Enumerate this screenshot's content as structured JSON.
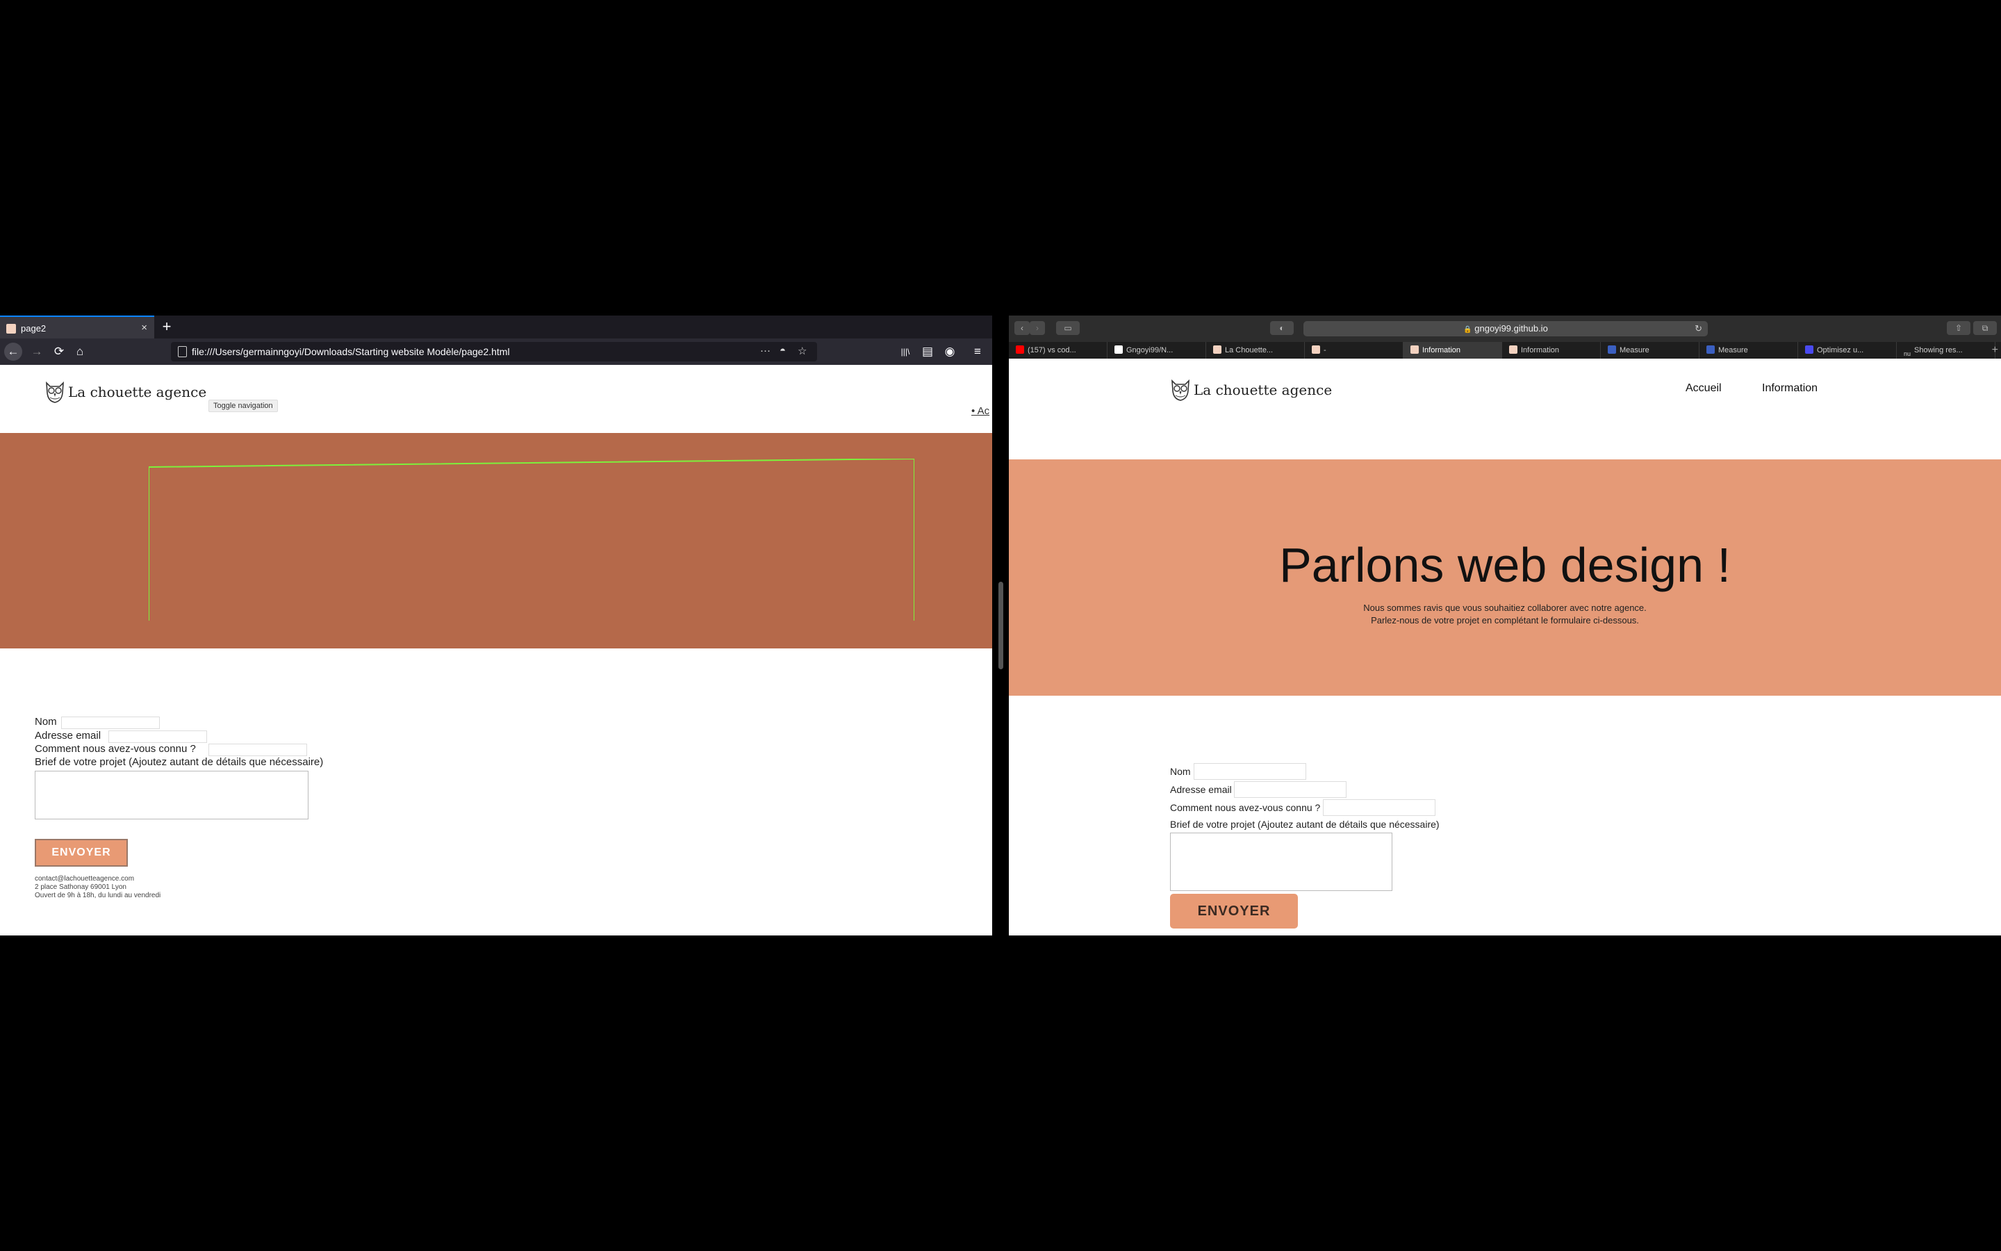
{
  "left_window": {
    "tab": {
      "title": "page2",
      "close": "×",
      "new_tab": "+"
    },
    "nav": {
      "back": "←",
      "forward": "→",
      "reload": "⟳",
      "home": "⌂"
    },
    "url": "file:///Users/germainngoyi/Downloads/Starting website Modèle/page2.html",
    "url_icons": {
      "more": "···",
      "pocket": "◓",
      "bookmark": "☆"
    },
    "toolbar_icons": {
      "library": "|||\\",
      "sidebar": "▤",
      "account": "◉",
      "menu": "≡"
    },
    "page": {
      "brand": "La chouette agence",
      "toggle_nav": "Toggle navigation",
      "nav_partial": "• Ac",
      "form": {
        "name_label": "Nom",
        "email_label": "Adresse email",
        "source_label": "Comment nous avez-vous connu ?",
        "brief_label": "Brief de votre projet (Ajoutez autant de détails que nécessaire)",
        "submit": "ENVOYER"
      },
      "footer": {
        "email": "contact@lachouetteagence.com",
        "address": "2 place Sathonay 69001 Lyon",
        "hours": "Ouvert de 9h à 18h, du lundi au vendredi"
      }
    }
  },
  "right_window": {
    "toolbar": {
      "back": "‹",
      "forward": "›",
      "sidebar": "▭",
      "shield": "◐",
      "address": "gngoyi99.github.io",
      "lock": "🔒",
      "reload": "↻",
      "share": "⇧",
      "tabs_overview": "⧉",
      "new_tab": "+"
    },
    "tabs": [
      {
        "label": "(157) vs cod...",
        "color": "#ff0000"
      },
      {
        "label": "Gngoyi99/N...",
        "color": "#ffffff"
      },
      {
        "label": "La Chouette...",
        "color": "#f3d2c0"
      },
      {
        "label": "-",
        "color": "#f3d2c0"
      },
      {
        "label": "Information",
        "color": "#f3d2c0",
        "active": true
      },
      {
        "label": "Information",
        "color": "#f3d2c0"
      },
      {
        "label": "Measure",
        "color": "#3b5fc0"
      },
      {
        "label": "Measure",
        "color": "#3b5fc0"
      },
      {
        "label": "Optimisez u...",
        "color": "#4a4af0"
      },
      {
        "label": "Showing res...",
        "color": "#1e1e1e",
        "prefix": "nu"
      }
    ],
    "page": {
      "brand": "La chouette agence",
      "nav": {
        "home": "Accueil",
        "info": "Information"
      },
      "hero": {
        "title": "Parlons web design !",
        "line1": "Nous sommes ravis que vous souhaitiez collaborer avec notre agence.",
        "line2": "Parlez-nous de votre projet en complétant le formulaire ci-dessous."
      },
      "form": {
        "name_label": "Nom",
        "email_label": "Adresse email",
        "source_label": "Comment nous avez-vous connu ?",
        "brief_label": "Brief de votre projet (Ajoutez autant de détails que nécessaire)",
        "submit": "ENVOYER"
      }
    }
  }
}
